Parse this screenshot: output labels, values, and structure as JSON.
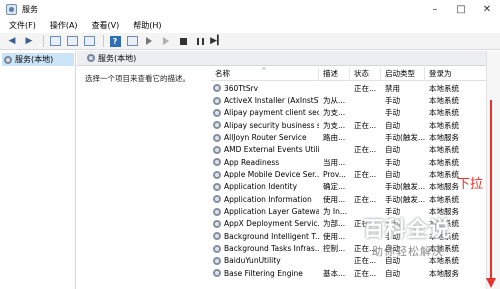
{
  "window": {
    "title": "服务"
  },
  "menu": [
    "文件(F)",
    "操作(A)",
    "查看(V)",
    "帮助(H)"
  ],
  "tree": {
    "root_label": "服务(本地)"
  },
  "pane": {
    "header_label": "服务(本地)",
    "description_prompt": "选择一个项目来查看它的描述。"
  },
  "table": {
    "columns": [
      "名称",
      "描述",
      "状态",
      "启动类型",
      "登录为"
    ],
    "rows": [
      {
        "name": "360TtSrv",
        "desc": "",
        "status": "正在...",
        "startup": "禁用",
        "logon": "本地系统"
      },
      {
        "name": "ActiveX Installer (AxInstSV)",
        "desc": "为从...",
        "status": "",
        "startup": "手动",
        "logon": "本地系统"
      },
      {
        "name": "Alipay payment client sec...",
        "desc": "为支...",
        "status": "",
        "startup": "手动",
        "logon": "本地系统"
      },
      {
        "name": "Alipay security business s...",
        "desc": "为支...",
        "status": "正在...",
        "startup": "自动",
        "logon": "本地系统"
      },
      {
        "name": "AllJoyn Router Service",
        "desc": "路由...",
        "status": "",
        "startup": "手动(触发...",
        "logon": "本地服务"
      },
      {
        "name": "AMD External Events Utility",
        "desc": "",
        "status": "正在...",
        "startup": "自动",
        "logon": "本地系统"
      },
      {
        "name": "App Readiness",
        "desc": "当用...",
        "status": "",
        "startup": "手动",
        "logon": "本地系统"
      },
      {
        "name": "Apple Mobile Device Ser...",
        "desc": "Prov...",
        "status": "正在...",
        "startup": "自动",
        "logon": "本地系统"
      },
      {
        "name": "Application Identity",
        "desc": "确定...",
        "status": "",
        "startup": "手动(触发...",
        "logon": "本地服务"
      },
      {
        "name": "Application Information",
        "desc": "使用...",
        "status": "正在...",
        "startup": "手动(触发...",
        "logon": "本地系统"
      },
      {
        "name": "Application Layer Gatewa...",
        "desc": "为 In...",
        "status": "",
        "startup": "手动",
        "logon": "本地服务"
      },
      {
        "name": "AppX Deployment Servic...",
        "desc": "为部...",
        "status": "正在...",
        "startup": "手动",
        "logon": "本地系统"
      },
      {
        "name": "Background Intelligent T...",
        "desc": "使用...",
        "status": "",
        "startup": "手动",
        "logon": "本地系统"
      },
      {
        "name": "Background Tasks Infras...",
        "desc": "控制...",
        "status": "正在...",
        "startup": "自动",
        "logon": "本地系统"
      },
      {
        "name": "BaiduYunUtility",
        "desc": "",
        "status": "正在...",
        "startup": "自动",
        "logon": "本地系统"
      },
      {
        "name": "Base Filtering Engine",
        "desc": "基本...",
        "status": "正在...",
        "startup": "自动",
        "logon": "本地服务"
      }
    ]
  },
  "annotation": {
    "drag_text": "下拉",
    "color": "#e5322d"
  },
  "watermark": {
    "main": "百科全说",
    "sub": "助你轻松解决"
  }
}
